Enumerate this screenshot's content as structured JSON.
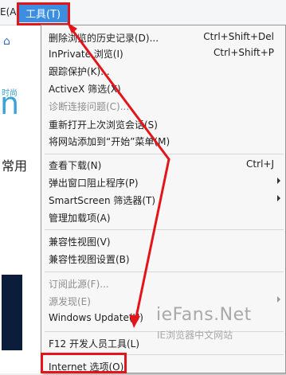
{
  "menubar": {
    "prev_label": "E(A)",
    "tools_label": "工具(T)"
  },
  "background": {
    "time_label": "时尚",
    "section_label": "常用"
  },
  "menu": {
    "items": [
      {
        "label": "删除浏览的历史记录(D)...",
        "shortcut": "Ctrl+Shift+Del"
      },
      {
        "label": "InPrivate 浏览(I)",
        "shortcut": "Ctrl+Shift+P"
      },
      {
        "label": "跟踪保护(K)...",
        "shortcut": ""
      },
      {
        "label": "ActiveX 筛选(X)",
        "shortcut": ""
      },
      {
        "label": "诊断连接问题(C)...",
        "shortcut": "",
        "disabled": true
      },
      {
        "label": "重新打开上次浏览会话(S)",
        "shortcut": ""
      },
      {
        "label": "将网站添加到“开始”菜单(M)",
        "shortcut": ""
      },
      {
        "label": "查看下载(N)",
        "shortcut": "Ctrl+J"
      },
      {
        "label": "弹出窗口阻止程序(P)",
        "shortcut": ""
      },
      {
        "label": "SmartScreen 筛选器(T)",
        "shortcut": ""
      },
      {
        "label": "管理加载项(A)",
        "shortcut": ""
      },
      {
        "label": "兼容性视图(V)",
        "shortcut": ""
      },
      {
        "label": "兼容性视图设置(B)",
        "shortcut": ""
      },
      {
        "label": "订阅此源(F)...",
        "shortcut": "",
        "disabled": true
      },
      {
        "label": "源发现(E)",
        "shortcut": "",
        "disabled": true
      },
      {
        "label": "Windows Update(U)",
        "shortcut": ""
      },
      {
        "label": "F12 开发人员工具(L)",
        "shortcut": ""
      },
      {
        "label": "Internet 选项(O)",
        "shortcut": ""
      }
    ]
  },
  "watermark": {
    "title": "ieFans.Net",
    "subtitle": "IE浏览器中文网站"
  },
  "colors": {
    "highlight": "#e4141b",
    "menu_active": "#3b8ee0"
  }
}
